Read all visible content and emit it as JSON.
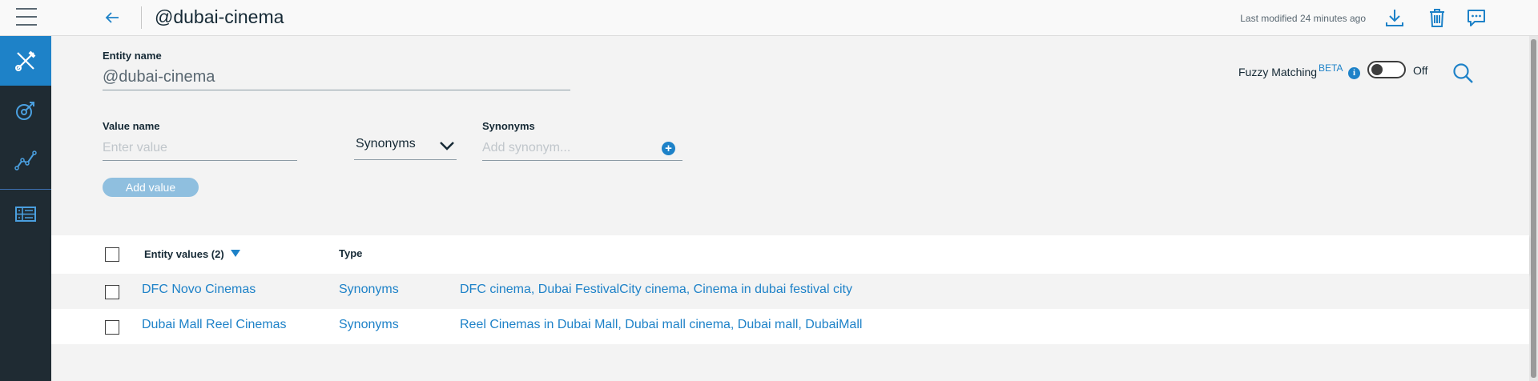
{
  "header": {
    "title": "@dubai-cinema",
    "last_modified": "Last modified 24 minutes ago",
    "icons": [
      "hamburger-icon",
      "back-arrow-icon",
      "download-icon",
      "trash-icon",
      "chat-icon"
    ]
  },
  "rail": {
    "items": [
      {
        "icon": "tools-icon",
        "active": true
      },
      {
        "icon": "deploy-icon",
        "active": false
      },
      {
        "icon": "analytics-icon",
        "active": false
      },
      {
        "icon": "dashboard-icon",
        "active": false
      }
    ]
  },
  "form": {
    "entity_name_label": "Entity name",
    "entity_name_value": "@dubai-cinema",
    "value_name_label": "Value name",
    "value_name_placeholder": "Enter value",
    "type_selected": "Synonyms",
    "synonyms_label": "Synonyms",
    "synonyms_placeholder": "Add synonym...",
    "add_value_label": "Add value"
  },
  "fuzzy": {
    "label": "Fuzzy Matching",
    "beta": "BETA",
    "info": "i",
    "state": "Off"
  },
  "table": {
    "col_values": "Entity values (2)",
    "col_type": "Type",
    "rows": [
      {
        "value": "DFC Novo Cinemas",
        "type": "Synonyms",
        "synonyms": "DFC cinema, Dubai FestivalCity cinema, Cinema in dubai festival city"
      },
      {
        "value": "Dubai Mall Reel Cinemas",
        "type": "Synonyms",
        "synonyms": "Reel Cinemas in Dubai Mall, Dubai mall cinema, Dubai mall, DubaiMall"
      }
    ]
  },
  "colors": {
    "accent": "#1e82c8",
    "rail_bg": "#1f2b33",
    "text": "#152935"
  }
}
